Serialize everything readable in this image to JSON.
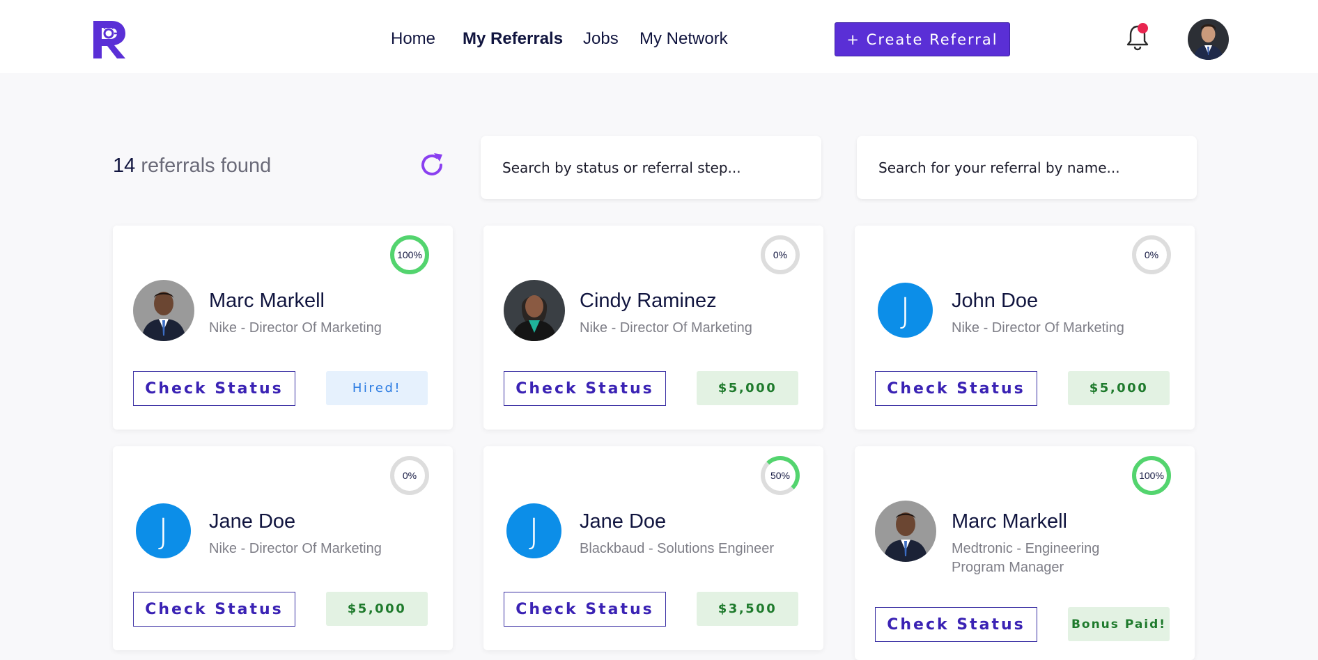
{
  "header": {
    "nav": [
      {
        "label": "Home"
      },
      {
        "label": "My Referrals"
      },
      {
        "label": "Jobs"
      },
      {
        "label": "My Network"
      }
    ],
    "create_label": "+ Create Referral"
  },
  "toolbar": {
    "count_number": "14",
    "count_label": "referrals found",
    "status_search_placeholder": "Search by status or referral step...",
    "name_search_placeholder": "Search for your referral by name..."
  },
  "colors": {
    "accent": "#5a2fd6",
    "progress_complete": "#53d46e",
    "avatar_initial_bg": "#0c8ee8",
    "notification_dot": "#e8254f"
  },
  "cards": [
    {
      "progress": "100%",
      "name": "Marc Markell",
      "role": "Nike - Director Of Marketing",
      "button": "Check Status",
      "badge": "Hired!"
    },
    {
      "progress": "0%",
      "name": "Cindy Raminez",
      "role": "Nike - Director Of Marketing",
      "button": "Check Status",
      "badge": "$5,000"
    },
    {
      "progress": "0%",
      "name": "John Doe",
      "initial": "J",
      "role": "Nike - Director Of Marketing",
      "button": "Check Status",
      "badge": "$5,000"
    },
    {
      "progress": "0%",
      "name": "Jane Doe",
      "initial": "J",
      "role": "Nike - Director Of Marketing",
      "button": "Check Status",
      "badge": "$5,000"
    },
    {
      "progress": "50%",
      "name": "Jane Doe",
      "initial": "J",
      "role": "Blackbaud - Solutions Engineer",
      "button": "Check Status",
      "badge": "$3,500"
    },
    {
      "progress": "100%",
      "name": "Marc Markell",
      "role": "Medtronic - Engineering Program Manager",
      "button": "Check Status",
      "badge": "Bonus Paid!"
    }
  ]
}
